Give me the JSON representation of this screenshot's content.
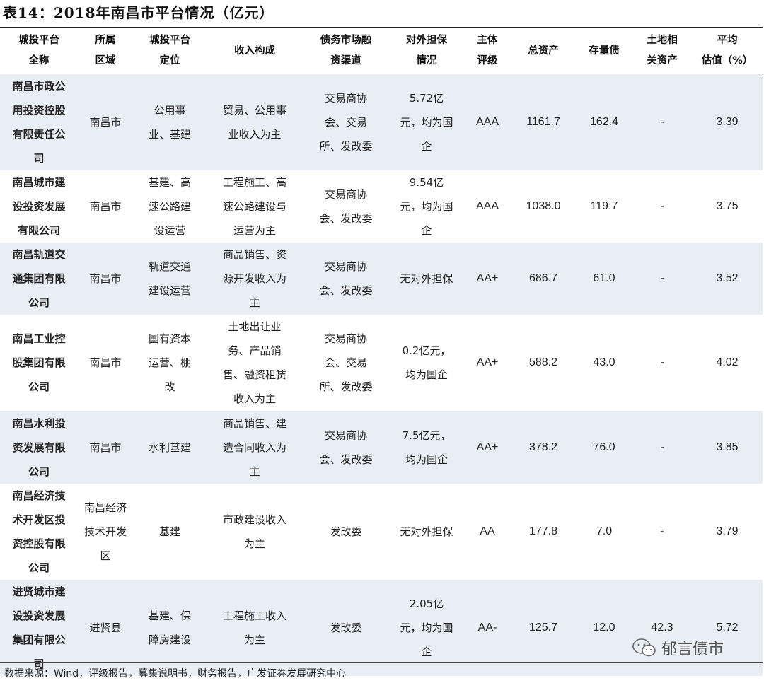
{
  "title": "表14：2018年南昌市平台情况（亿元）",
  "headers": [
    [
      "城投平台",
      "全称"
    ],
    [
      "所属",
      "区域"
    ],
    [
      "城投平台",
      "定位"
    ],
    [
      "收入构成"
    ],
    [
      "债务市场融",
      "资渠道"
    ],
    [
      "对外担保",
      "情况"
    ],
    [
      "主体",
      "评级"
    ],
    [
      "总资产"
    ],
    [
      "存量债"
    ],
    [
      "土地相",
      "关资产"
    ],
    [
      "平均",
      "估值（%）"
    ]
  ],
  "rows": [
    {
      "name": "南昌市政公用投资控股有限责任公司",
      "region": "南昌市",
      "position": "公用事业、基建",
      "income": "贸易、公用事业收入为主",
      "channel": "交易商协会、交易所、发改委",
      "guarantee": "5.72亿元，均为国企",
      "rating": "AAA",
      "assets": "1161.7",
      "debt": "162.4",
      "land": "-",
      "valuation": "3.39"
    },
    {
      "name": "南昌城市建设投资发展有限公司",
      "region": "南昌市",
      "position": "基建、高速公路建设运营",
      "income": "工程施工、高速公路建设与运营为主",
      "channel": "交易商协会、发改委",
      "guarantee": "9.54亿元，均为国企",
      "rating": "AAA",
      "assets": "1038.0",
      "debt": "119.7",
      "land": "-",
      "valuation": "3.75"
    },
    {
      "name": "南昌轨道交通集团有限公司",
      "region": "南昌市",
      "position": "轨道交通建设运营",
      "income": "商品销售、资源开发收入为主",
      "channel": "交易商协会、发改委",
      "guarantee": "无对外担保",
      "rating": "AA+",
      "assets": "686.7",
      "debt": "61.0",
      "land": "-",
      "valuation": "3.52"
    },
    {
      "name": "南昌工业控股集团有限公司",
      "region": "南昌市",
      "position": "国有资本运营、棚改",
      "income": "土地出让业务、产品销售、融资租赁收入为主",
      "channel": "交易商协会、交易所、发改委",
      "guarantee": "0.2亿元，均为国企",
      "rating": "AA+",
      "assets": "588.2",
      "debt": "43.0",
      "land": "-",
      "valuation": "4.02"
    },
    {
      "name": "南昌水利投资发展有限公司",
      "region": "南昌市",
      "position": "水利基建",
      "income": "商品销售、建造合同收入为主",
      "channel": "交易商协会、发改委",
      "guarantee": "7.5亿元，均为国企",
      "rating": "AA+",
      "assets": "378.2",
      "debt": "76.0",
      "land": "-",
      "valuation": "3.85"
    },
    {
      "name": "南昌经济技术开发区投资控股有限公司",
      "region": "南昌经济技术开发区",
      "position": "基建",
      "income": "市政建设收入为主",
      "channel": "发改委",
      "guarantee": "无对外担保",
      "rating": "AA",
      "assets": "177.8",
      "debt": "7.0",
      "land": "-",
      "valuation": "3.79"
    },
    {
      "name": "进贤城市建设投资发展集团有限公司",
      "region": "进贤县",
      "position": "基建、保障房建设",
      "income": "工程施工收入为主",
      "channel": "发改委",
      "guarantee": "2.05亿元，均为国企",
      "rating": "AA-",
      "assets": "125.7",
      "debt": "12.0",
      "land": "42.3",
      "valuation": "5.72"
    }
  ],
  "source": "数据来源：Wind，评级报告，募集说明书，财务报告，广发证券发展研究中心",
  "watermark": "郁言债市",
  "icons": {
    "watermark": "wechat-icon"
  }
}
